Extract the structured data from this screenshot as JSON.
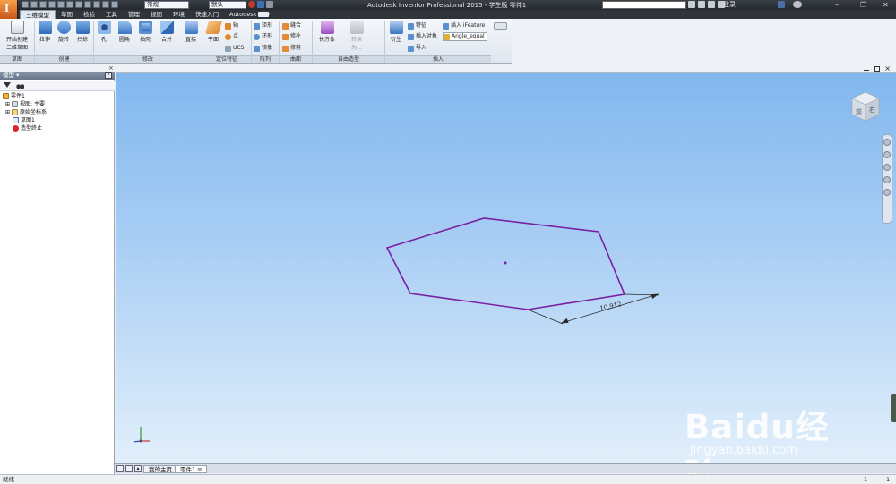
{
  "titlebar": {
    "title": "Autodesk Inventor Professional 2015 - 学生版    零件1",
    "style_combo": "常规",
    "material_combo": "默认",
    "login": "登录",
    "window_controls": [
      "–",
      "❐",
      "✕"
    ]
  },
  "menu_tabs": [
    "三维模型",
    "草图",
    "检验",
    "工具",
    "管理",
    "视图",
    "环境",
    "快速入门",
    "Autodesk 360"
  ],
  "ribbon": {
    "sketch": {
      "start_2d_line1": "开始创建",
      "start_2d_line2": "二维草图",
      "group": "草图"
    },
    "create": {
      "extrude": "拉伸",
      "revolve": "旋转",
      "sweep": "扫掠",
      "group": "创建"
    },
    "modify": {
      "hole": "孔",
      "fillet": "圆角",
      "shell": "抽壳",
      "combine": "合并",
      "direct": "直接",
      "group": "修改"
    },
    "work_features": {
      "plane": "平面",
      "axis": "轴",
      "point": "点",
      "ucs": "UCS",
      "group": "定位特征"
    },
    "pattern": {
      "rect": "矩形",
      "circ": "环形",
      "mirror": "镜像",
      "group": "阵列"
    },
    "surface": {
      "stitch": "缝合",
      "patch": "修补",
      "trim": "修剪",
      "group": "曲面"
    },
    "freeform": {
      "box": "长方体",
      "convert_line1": "转换",
      "convert_line2": "为...",
      "group": "自由造型"
    },
    "insert": {
      "derive": "衍生",
      "feature": "特征",
      "insert_object": "插入对象",
      "import": "导入",
      "ifeature": "插入 iFeature",
      "param": "Angle_equal",
      "group": "插入"
    }
  },
  "browser": {
    "title": "模型 ▾",
    "tree": [
      "零件1",
      "视图: 主要",
      "原始坐标系",
      "草图1",
      "造型终止"
    ]
  },
  "canvas": {
    "dimension_value": "10.912",
    "viewcube_front": "前",
    "viewcube_right": "右"
  },
  "doc_tabs": [
    "我的主页",
    "零件1"
  ],
  "status": {
    "left": "就绪",
    "right_a": "1",
    "right_b": "1"
  },
  "watermark": {
    "brand": "Baidu经验",
    "url": "jingyan.baidu.com"
  },
  "colors": {
    "profile": "#7a1fa2",
    "dimension": "#1a1a1a",
    "ribbon_bg": "#e3e9f0",
    "canvas_top": "#7fb6ee",
    "canvas_bottom": "#e2effb"
  }
}
